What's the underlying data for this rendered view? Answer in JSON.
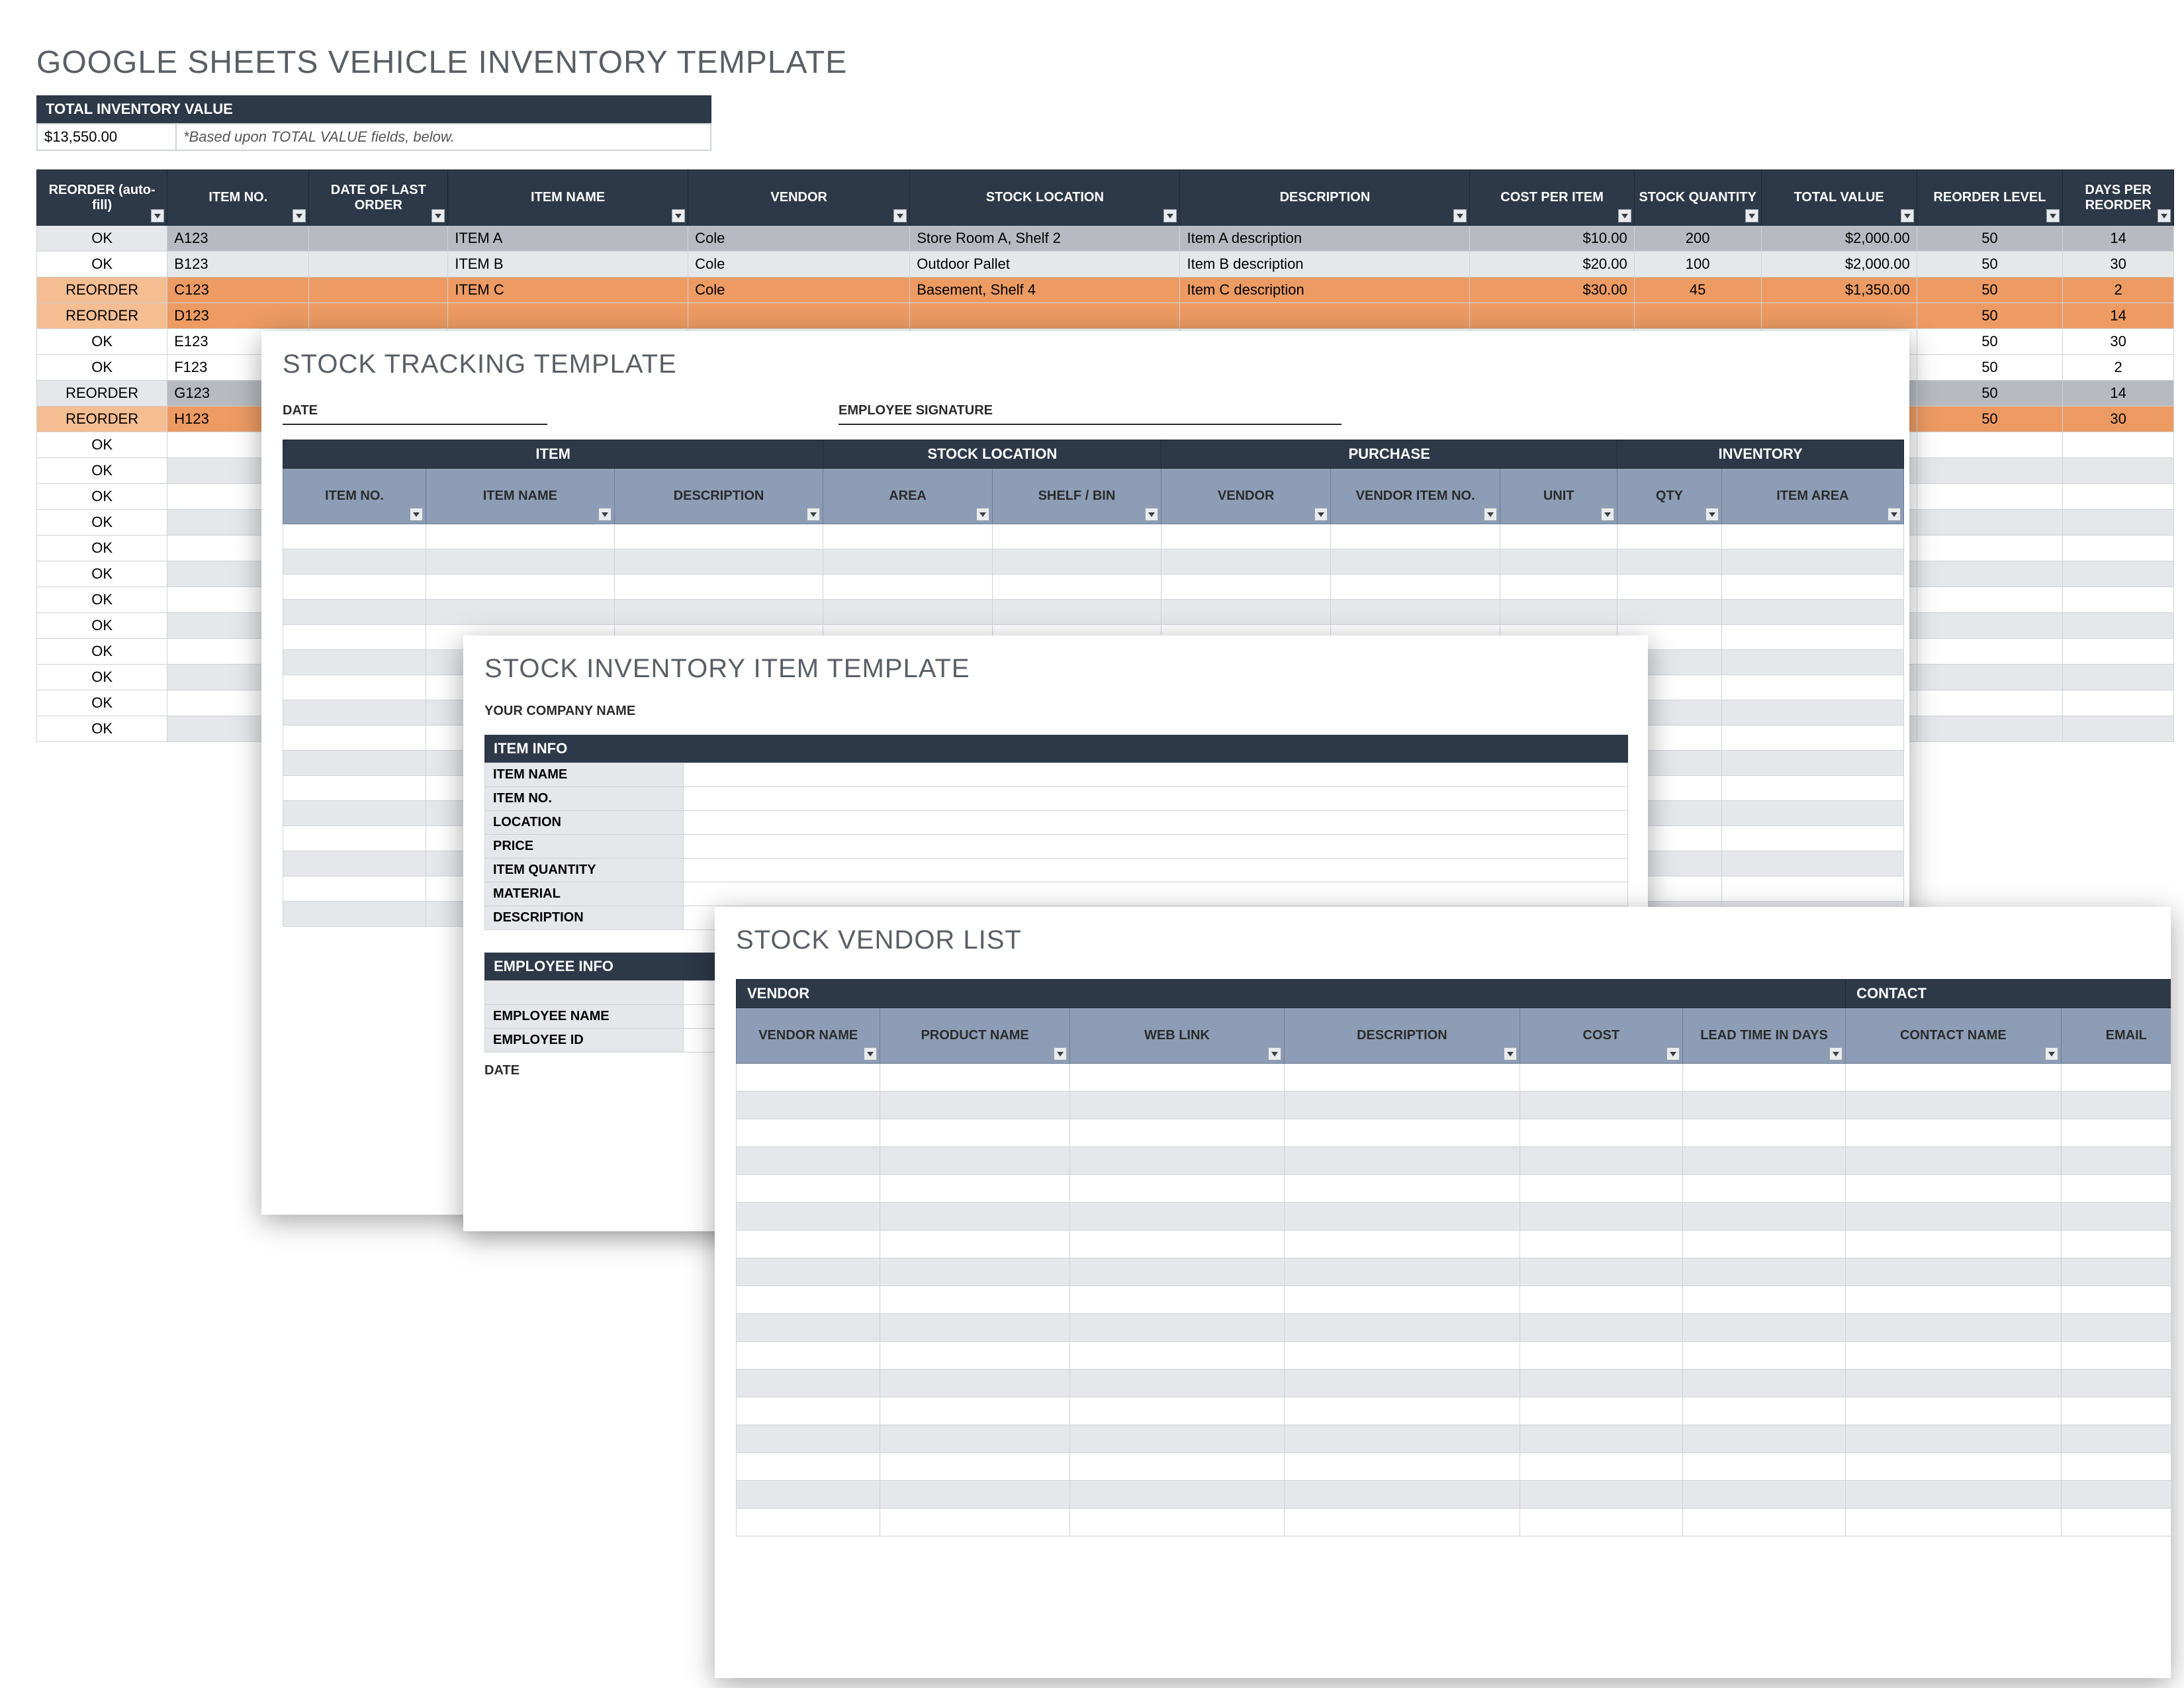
{
  "vehicle": {
    "title": "GOOGLE SHEETS VEHICLE INVENTORY TEMPLATE",
    "tiv_label": "TOTAL INVENTORY VALUE",
    "tiv_value": "$13,550.00",
    "tiv_note": "*Based upon TOTAL VALUE fields, below.",
    "headers": {
      "reorder": "REORDER (auto-fill)",
      "item_no": "ITEM NO.",
      "date_last": "DATE OF LAST ORDER",
      "item_name": "ITEM NAME",
      "vendor": "VENDOR",
      "stock_loc": "STOCK LOCATION",
      "description": "DESCRIPTION",
      "cost": "COST PER ITEM",
      "stock_qty": "STOCK QUANTITY",
      "total_value": "TOTAL VALUE",
      "reorder_level": "REORDER LEVEL",
      "days_per": "DAYS PER REORDER"
    },
    "rows": [
      {
        "status": "OK",
        "item_no": "A123",
        "item_name": "ITEM A",
        "vendor": "Cole",
        "stock_loc": "Store Room A, Shelf 2",
        "description": "Item A description",
        "cost": "$10.00",
        "qty": "200",
        "total": "$2,000.00",
        "reorder": "50",
        "days": "14",
        "tone": "dkgrey"
      },
      {
        "status": "OK",
        "item_no": "B123",
        "item_name": "ITEM B",
        "vendor": "Cole",
        "stock_loc": "Outdoor Pallet",
        "description": "Item B description",
        "cost": "$20.00",
        "qty": "100",
        "total": "$2,000.00",
        "reorder": "50",
        "days": "30",
        "tone": "grey"
      },
      {
        "status": "REORDER",
        "item_no": "C123",
        "item_name": "ITEM C",
        "vendor": "Cole",
        "stock_loc": "Basement, Shelf 4",
        "description": "Item C description",
        "cost": "$30.00",
        "qty": "45",
        "total": "$1,350.00",
        "reorder": "50",
        "days": "2",
        "tone": "orange"
      },
      {
        "status": "REORDER",
        "item_no": "D123",
        "item_name": "",
        "vendor": "",
        "stock_loc": "",
        "description": "",
        "cost": "",
        "qty": "",
        "total": "",
        "reorder": "50",
        "days": "14",
        "tone": "orange"
      },
      {
        "status": "OK",
        "item_no": "E123",
        "item_name": "",
        "vendor": "",
        "stock_loc": "",
        "description": "",
        "cost": "",
        "qty": "",
        "total": "",
        "reorder": "50",
        "days": "30",
        "tone": "plain"
      },
      {
        "status": "OK",
        "item_no": "F123",
        "item_name": "",
        "vendor": "",
        "stock_loc": "",
        "description": "",
        "cost": "",
        "qty": "",
        "total": "",
        "reorder": "50",
        "days": "2",
        "tone": "plain"
      },
      {
        "status": "REORDER",
        "item_no": "G123",
        "item_name": "",
        "vendor": "",
        "stock_loc": "",
        "description": "",
        "cost": "",
        "qty": "",
        "total": "",
        "reorder": "50",
        "days": "14",
        "tone": "dkgrey"
      },
      {
        "status": "REORDER",
        "item_no": "H123",
        "item_name": "",
        "vendor": "",
        "stock_loc": "",
        "description": "",
        "cost": "",
        "qty": "",
        "total": "",
        "reorder": "50",
        "days": "30",
        "tone": "orange"
      }
    ],
    "ok_rows": 12,
    "ok_label": "OK"
  },
  "tracking": {
    "title": "STOCK TRACKING TEMPLATE",
    "date_lbl": "DATE",
    "sig_lbl": "EMPLOYEE SIGNATURE",
    "groups": {
      "item": "ITEM",
      "stock": "STOCK LOCATION",
      "purchase": "PURCHASE",
      "inventory": "INVENTORY"
    },
    "headers": {
      "item_no": "ITEM NO.",
      "item_name": "ITEM NAME",
      "description": "DESCRIPTION",
      "area": "AREA",
      "shelf": "SHELF / BIN",
      "vendor": "VENDOR",
      "vendor_item": "VENDOR ITEM NO.",
      "unit": "UNIT",
      "qty": "QTY",
      "item_area": "ITEM AREA"
    },
    "blank_rows": 16
  },
  "item": {
    "title": "STOCK INVENTORY ITEM TEMPLATE",
    "company_lbl": "YOUR COMPANY NAME",
    "item_info_hdr": "ITEM INFO",
    "labels": {
      "item_name": "ITEM NAME",
      "item_no": "ITEM NO.",
      "location": "LOCATION",
      "price": "PRICE",
      "qty": "ITEM QUANTITY",
      "material": "MATERIAL",
      "description": "DESCRIPTION"
    },
    "emp_info_hdr": "EMPLOYEE INFO",
    "emp_labels": {
      "name": "EMPLOYEE NAME",
      "id": "EMPLOYEE ID"
    },
    "date_lbl": "DATE"
  },
  "vendor": {
    "title": "STOCK VENDOR LIST",
    "groups": {
      "vendor": "VENDOR",
      "contact": "CONTACT"
    },
    "headers": {
      "vendor_name": "VENDOR NAME",
      "product": "PRODUCT NAME",
      "web": "WEB LINK",
      "description": "DESCRIPTION",
      "cost": "COST",
      "lead": "LEAD TIME IN DAYS",
      "contact_name": "CONTACT NAME",
      "email": "EMAIL"
    },
    "blank_rows": 17
  }
}
